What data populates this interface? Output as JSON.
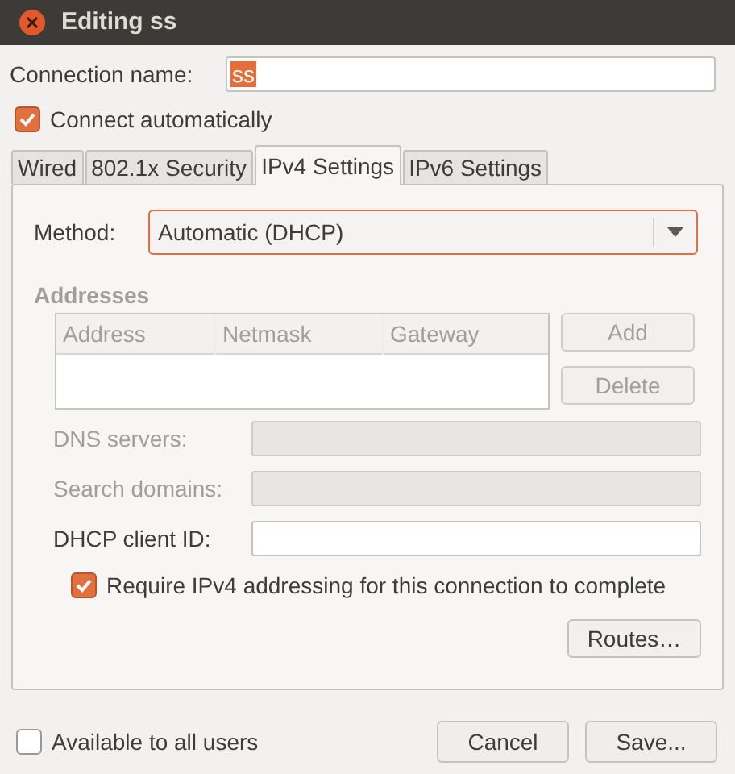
{
  "window": {
    "title": "Editing ss"
  },
  "connection_name": {
    "label": "Connection name:",
    "value": "ss"
  },
  "connect_automatically": {
    "label": "Connect automatically",
    "checked": true
  },
  "tabs": [
    {
      "label": "Wired",
      "selected": false
    },
    {
      "label": "802.1x Security",
      "selected": false
    },
    {
      "label": "IPv4 Settings",
      "selected": true
    },
    {
      "label": "IPv6 Settings",
      "selected": false
    }
  ],
  "method": {
    "label": "Method:",
    "value": "Automatic (DHCP)"
  },
  "addresses": {
    "title": "Addresses",
    "disabled": true,
    "columns": [
      "Address",
      "Netmask",
      "Gateway"
    ],
    "buttons": [
      "Add",
      "Delete"
    ]
  },
  "fields": [
    {
      "label": "DNS servers:",
      "disabled": true
    },
    {
      "label": "Search domains:",
      "disabled": true
    },
    {
      "label": "DHCP client ID:",
      "disabled": false
    }
  ],
  "require_ipv4": {
    "label": "Require IPv4 addressing for this connection to complete",
    "checked": true
  },
  "routes_button": "Routes…",
  "available_to_all_users": {
    "label": "Available to all users",
    "checked": false
  },
  "buttons": [
    "Cancel",
    "Save..."
  ]
}
